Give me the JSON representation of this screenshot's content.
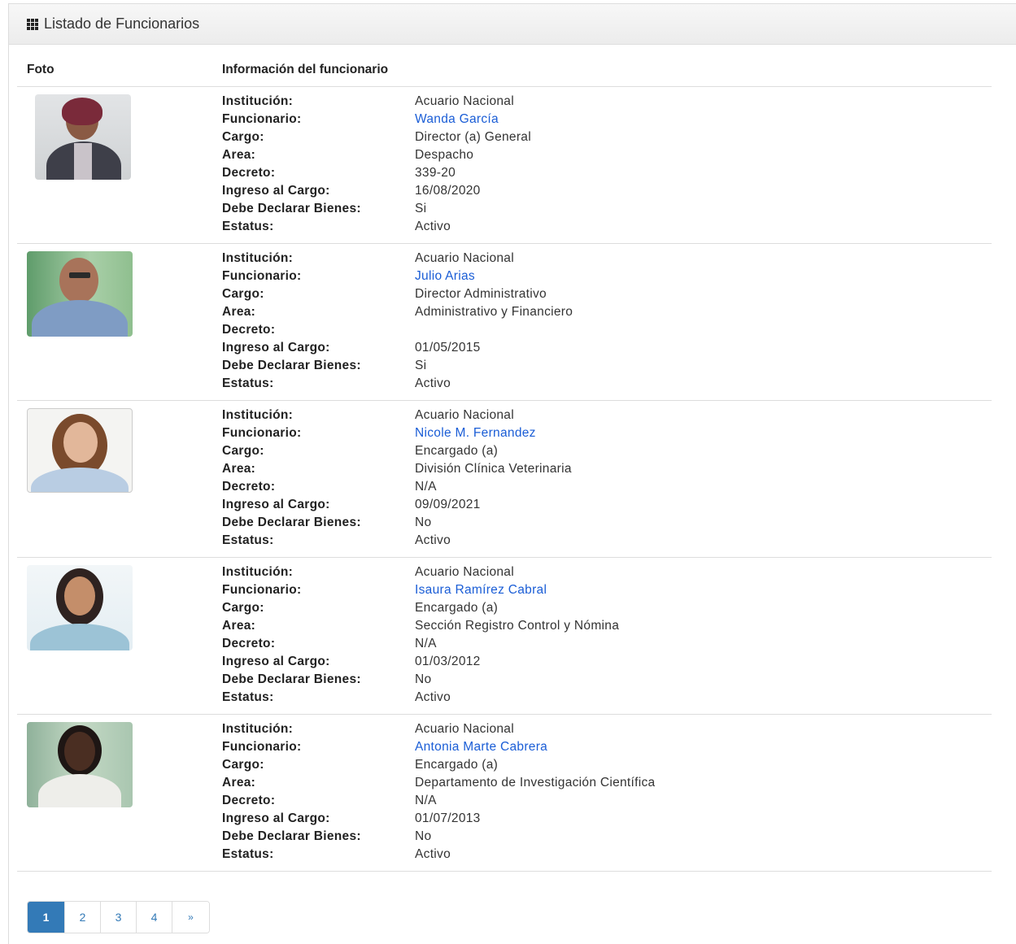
{
  "panel": {
    "title": "Listado de Funcionarios"
  },
  "table": {
    "headers": {
      "foto": "Foto",
      "info": "Información del funcionario"
    },
    "labels": {
      "institucion": "Institución:",
      "funcionario": "Funcionario:",
      "cargo": "Cargo:",
      "area": "Area:",
      "decreto": "Decreto:",
      "ingreso": "Ingreso al Cargo:",
      "declarar": "Debe Declarar Bienes:",
      "estatus": "Estatus:"
    },
    "rows": [
      {
        "institucion": "Acuario Nacional",
        "funcionario": "Wanda García",
        "cargo": "Director (a) General",
        "area": "Despacho",
        "decreto": "339-20",
        "ingreso": "16/08/2020",
        "declarar": "Si",
        "estatus": "Activo"
      },
      {
        "institucion": "Acuario Nacional",
        "funcionario": "Julio Arias",
        "cargo": "Director Administrativo",
        "area": "Administrativo y Financiero",
        "decreto": "",
        "ingreso": "01/05/2015",
        "declarar": "Si",
        "estatus": "Activo"
      },
      {
        "institucion": "Acuario Nacional",
        "funcionario": "Nicole M. Fernandez",
        "cargo": "Encargado (a)",
        "area": "División Clínica Veterinaria",
        "decreto": "N/A",
        "ingreso": "09/09/2021",
        "declarar": "No",
        "estatus": "Activo"
      },
      {
        "institucion": "Acuario Nacional",
        "funcionario": "Isaura Ramírez Cabral",
        "cargo": "Encargado (a)",
        "area": "Sección Registro Control y Nómina",
        "decreto": "N/A",
        "ingreso": "01/03/2012",
        "declarar": "No",
        "estatus": "Activo"
      },
      {
        "institucion": "Acuario Nacional",
        "funcionario": "Antonia Marte Cabrera",
        "cargo": "Encargado (a)",
        "area": "Departamento de Investigación Científica",
        "decreto": "N/A",
        "ingreso": "01/07/2013",
        "declarar": "No",
        "estatus": "Activo"
      }
    ]
  },
  "pagination": {
    "pages": [
      "1",
      "2",
      "3",
      "4"
    ],
    "next": "»",
    "active": "1"
  },
  "colors": {
    "link": "#1a5dd6",
    "active_page": "#337ab7"
  },
  "icons": {
    "title": "grid-icon"
  }
}
